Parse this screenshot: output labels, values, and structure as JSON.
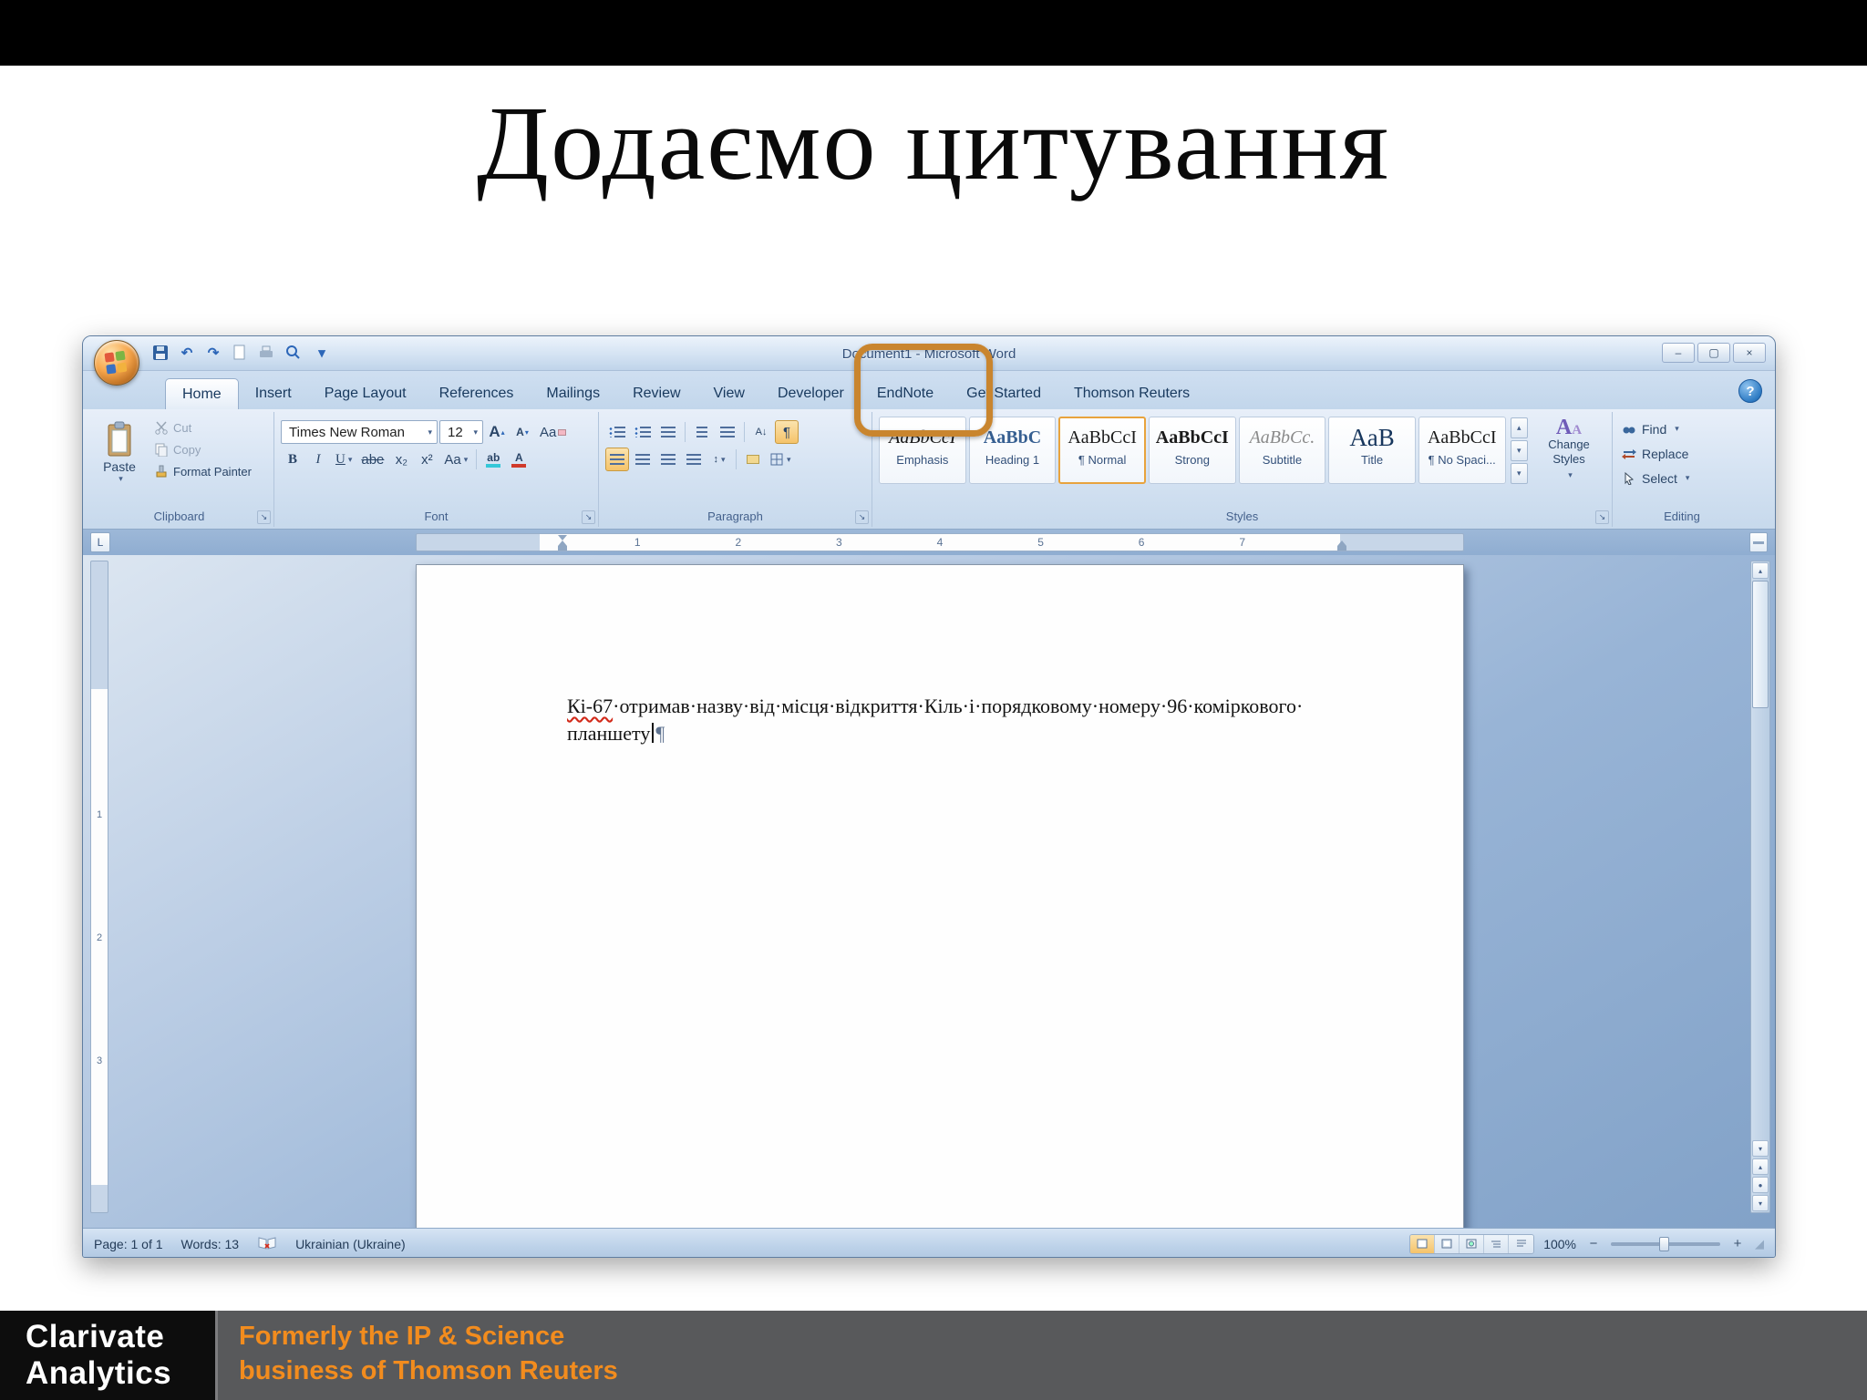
{
  "slide": {
    "title": "Додаємо цитування"
  },
  "window": {
    "title": "Document1 - Microsoft Word",
    "minimize": "–",
    "maximize": "▢",
    "close": "×",
    "help": "?"
  },
  "tabs": [
    {
      "label": "Home"
    },
    {
      "label": "Insert"
    },
    {
      "label": "Page Layout"
    },
    {
      "label": "References"
    },
    {
      "label": "Mailings"
    },
    {
      "label": "Review"
    },
    {
      "label": "View"
    },
    {
      "label": "Developer"
    },
    {
      "label": "EndNote"
    },
    {
      "label": "Get Started"
    },
    {
      "label": "Thomson Reuters"
    }
  ],
  "ribbon": {
    "clipboard": {
      "group_label": "Clipboard",
      "paste": "Paste",
      "cut": "Cut",
      "copy": "Copy",
      "format_painter": "Format Painter"
    },
    "font": {
      "group_label": "Font",
      "font_name": "Times New Roman",
      "font_size": "12",
      "grow": "A",
      "shrink": "A",
      "clear": "Aa",
      "bold": "B",
      "italic": "I",
      "underline": "U",
      "strikethrough": "abe",
      "subscript": "x₂",
      "superscript": "x²",
      "change_case": "Aa",
      "highlight": "ab",
      "font_color": "A"
    },
    "paragraph": {
      "group_label": "Paragraph",
      "pilcrow": "¶"
    },
    "styles": {
      "group_label": "Styles",
      "items": [
        {
          "preview": "AaBbCcI",
          "label": "Emphasis"
        },
        {
          "preview": "AaBbC",
          "label": "Heading 1"
        },
        {
          "preview": "AaBbCcI",
          "label": "¶ Normal"
        },
        {
          "preview": "AaBbCcI",
          "label": "Strong"
        },
        {
          "preview": "AaBbCc.",
          "label": "Subtitle"
        },
        {
          "preview": "AaB",
          "label": "Title"
        },
        {
          "preview": "AaBbCcI",
          "label": "¶ No Spaci..."
        }
      ],
      "change_styles": "Change Styles"
    },
    "editing": {
      "group_label": "Editing",
      "find": "Find",
      "replace": "Replace",
      "select": "Select"
    }
  },
  "ruler": {
    "tab_selector": "L",
    "h": [
      "1",
      "2",
      "3",
      "4",
      "5",
      "6",
      "7"
    ],
    "v": [
      "1",
      "2",
      "3"
    ]
  },
  "document": {
    "line1_word1": "Кі-67",
    "line1_rest": "·отримав·назву·від·місця·відкриття·Кіль·і·порядковому·номеру·96·коміркового·",
    "line2": "планшету",
    "paragraph_mark": "¶"
  },
  "status_bar": {
    "page": "Page: 1 of 1",
    "words": "Words: 13",
    "language": "Ukrainian (Ukraine)",
    "zoom": "100%"
  },
  "footer": {
    "brand_line1": "Clarivate",
    "brand_line2": "Analytics",
    "tagline_line1": "Formerly the IP & Science",
    "tagline_line2": "business of Thomson Reuters"
  },
  "icons": {
    "dropdown": "▾",
    "up": "▴",
    "down": "▾",
    "undo": "↶",
    "redo": "↷",
    "sort": "A↓",
    "line_spacing": "↕",
    "circle": "●",
    "minus": "−",
    "plus": "+",
    "grip": "◢",
    "style_a": "A",
    "launcher": "↘"
  },
  "colors": {
    "highlight_box": "#C9852E",
    "footer_orange": "#F28C1E",
    "selection_orange": "#F5C36A"
  }
}
